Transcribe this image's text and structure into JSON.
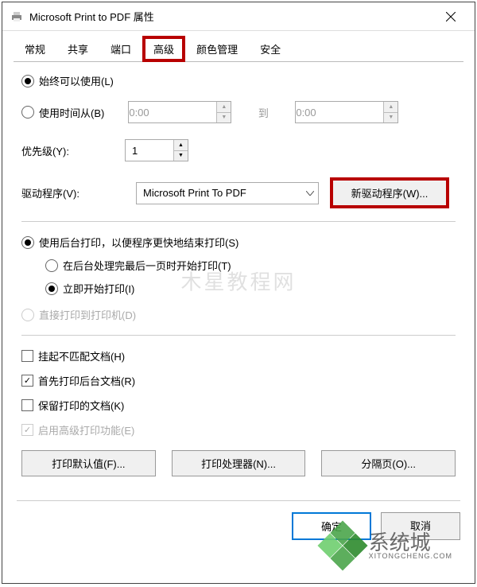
{
  "title": "Microsoft Print to PDF 属性",
  "tabs": [
    "常规",
    "共享",
    "端口",
    "高级",
    "颜色管理",
    "安全"
  ],
  "activeTab": 3,
  "availability": {
    "always": "始终可以使用(L)",
    "from": "使用时间从(B)",
    "time1": "0:00",
    "to": "到",
    "time2": "0:00"
  },
  "priority": {
    "label": "优先级(Y):",
    "value": "1"
  },
  "driver": {
    "label": "驱动程序(V):",
    "value": "Microsoft Print To PDF",
    "btn": "新驱动程序(W)..."
  },
  "spool": {
    "group": "使用后台打印，以便程序更快地结束打印(S)",
    "after": "在后台处理完最后一页时开始打印(T)",
    "imm": "立即开始打印(I)",
    "direct": "直接打印到打印机(D)"
  },
  "checks": {
    "hold": "挂起不匹配文档(H)",
    "spooled": "首先打印后台文档(R)",
    "keep": "保留打印的文档(K)",
    "adv": "启用高级打印功能(E)"
  },
  "btns": {
    "defaults": "打印默认值(F)...",
    "processor": "打印处理器(N)...",
    "separator": "分隔页(O)..."
  },
  "dlg": {
    "ok": "确定",
    "cancel": "取消"
  },
  "watermark": {
    "center": "木星教程网",
    "brand": "系统城",
    "url": "XITONGCHENG.COM"
  }
}
